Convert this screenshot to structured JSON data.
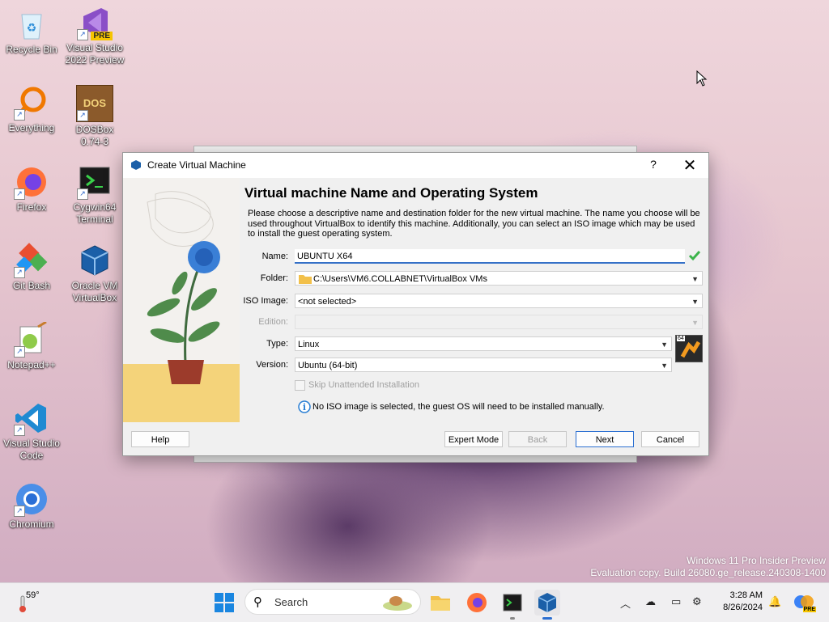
{
  "desktop": {
    "icons": [
      {
        "label": "Recycle Bin"
      },
      {
        "label": "Visual Studio 2022 Preview",
        "badge": "PRE"
      },
      {
        "label": "Everything"
      },
      {
        "label": "DOSBox 0.74-3",
        "glyph": "DOS"
      },
      {
        "label": "Firefox"
      },
      {
        "label": "Cygwin64 Terminal"
      },
      {
        "label": "Git Bash"
      },
      {
        "label": "Oracle VM VirtualBox"
      },
      {
        "label": "Notepad++"
      },
      {
        "label": "Visual Studio Code"
      },
      {
        "label": "Chromium"
      }
    ],
    "watermark": {
      "line1": "Windows 11 Pro Insider Preview",
      "line2": "Evaluation copy. Build 26080.ge_release.240308-1400"
    }
  },
  "dialog": {
    "title": "Create Virtual Machine",
    "help_glyph": "?",
    "close_glyph": "✕",
    "heading": "Virtual machine Name and Operating System",
    "description": "Please choose a descriptive name and destination folder for the new virtual machine. The name you choose will be used throughout VirtualBox to identify this machine. Additionally, you can select an ISO image which may be used to install the guest operating system.",
    "name_label": "Name:",
    "name_value": "UBUNTU X64",
    "folder_label": "Folder:",
    "folder_value": "C:\\Users\\VM6.COLLABNET\\VirtualBox VMs",
    "iso_label": "ISO Image:",
    "iso_value": "<not selected>",
    "edition_label": "Edition:",
    "type_label": "Type:",
    "type_value": "Linux",
    "version_label": "Version:",
    "version_value": "Ubuntu (64-bit)",
    "os_badge": "64",
    "skip_label": "Skip Unattended Installation",
    "info_text": "No ISO image is selected, the guest OS will need to be installed manually.",
    "buttons": {
      "help": "Help",
      "expert": "Expert Mode",
      "back": "Back",
      "next": "Next",
      "cancel": "Cancel"
    }
  },
  "taskbar": {
    "weather_temp": "59°",
    "search_placeholder": "Search",
    "time": "3:28 AM",
    "date": "8/26/2024",
    "copilot_badge": "PRE"
  },
  "colors": {
    "accent": "#2b6fd1",
    "check": "#3bb34a",
    "info": "#2a7fd4"
  }
}
